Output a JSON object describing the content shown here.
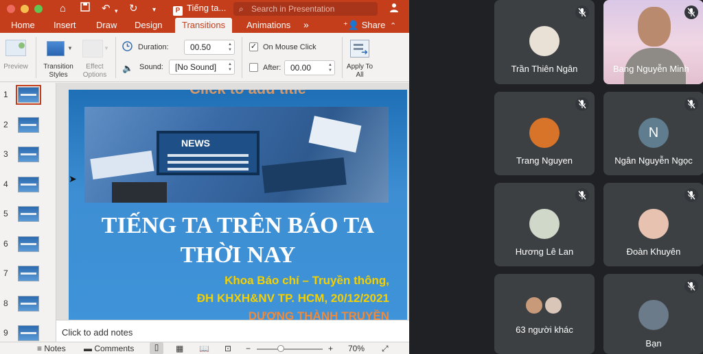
{
  "ppt": {
    "doc_title": "Tiếng ta...",
    "search_placeholder": "Search in Presentation",
    "tabs": [
      "Home",
      "Insert",
      "Draw",
      "Design",
      "Transitions",
      "Animations"
    ],
    "more_tabs": "»",
    "share_label": "Share",
    "ribbon": {
      "preview": "Preview",
      "transition_styles": "Transition Styles",
      "effect_options": "Effect Options",
      "duration_label": "Duration:",
      "duration_value": "00.50",
      "sound_label": "Sound:",
      "sound_value": "[No Sound]",
      "on_mouse_click": "On Mouse Click",
      "on_mouse_click_checked": true,
      "after_label": "After:",
      "after_value": "00.00",
      "apply_to_all": "Apply To All"
    },
    "thumbnails": [
      "1",
      "2",
      "3",
      "4",
      "5",
      "6",
      "7",
      "8",
      "9"
    ],
    "selected_slide": 1,
    "slide": {
      "ghost_title": "Click to add title",
      "news_word": "NEWS",
      "title_line1": "TIẾNG TA TRÊN BÁO TA",
      "title_line2": "THỜI NAY",
      "sub1": "Khoa Báo chí – Truyền thông,",
      "sub2": "ĐH KHXH&NV TP. HCM, 20/12/2021",
      "sub3": "DƯƠNG THÀNH TRUYỀN"
    },
    "notes_placeholder": "Click to add notes",
    "status": {
      "notes": "Notes",
      "comments": "Comments",
      "zoom": "70%"
    }
  },
  "meet": {
    "tiles": [
      {
        "name": "Trần Thiên Ngân",
        "kind": "photo"
      },
      {
        "name": "Bang Nguyễn Minh",
        "kind": "video"
      },
      {
        "name": "Trang Nguyen",
        "kind": "photo"
      },
      {
        "name": "Ngân Nguyễn Ngọc",
        "kind": "initial",
        "initial": "N"
      },
      {
        "name": "Hương Lê Lan",
        "kind": "photo"
      },
      {
        "name": "Đoàn Khuyên",
        "kind": "photo"
      },
      {
        "name": "63 người khác",
        "kind": "group"
      },
      {
        "name": "Bạn",
        "kind": "photo"
      }
    ],
    "colors": {
      "tile_bg": "#3c4043",
      "page_bg": "#202124",
      "initial_avatar": "#5f7d8e"
    }
  },
  "colors": {
    "ppt_accent": "#c43e1c"
  }
}
